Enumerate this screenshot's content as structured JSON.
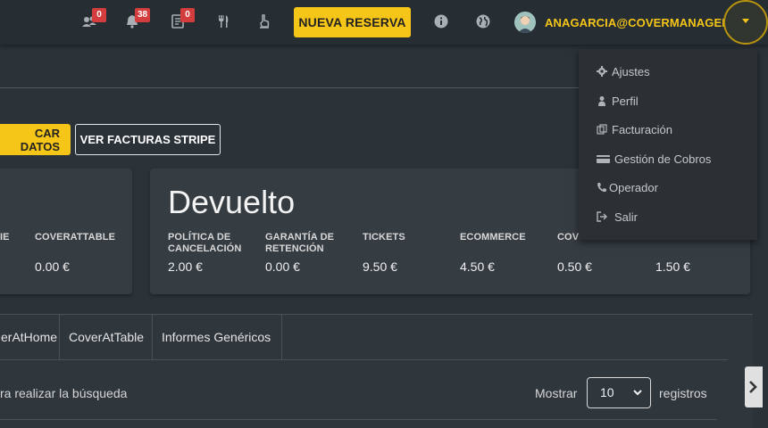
{
  "topbar": {
    "badges": {
      "groups": "0",
      "notifications": "38",
      "tasks": "0"
    },
    "reserve_label": "NUEVA RESERVA",
    "user_email": "ANAGARCIA@COVERMANAGER.COM"
  },
  "actions": {
    "buscar_label": "CAR DATOS",
    "stripe_label": "VER FACTURAS STRIPE"
  },
  "card_left": {
    "col1_label": "IE",
    "col2_label": "COVERATTABLE",
    "col2_value": "0.00 €"
  },
  "card_main": {
    "title": "Devuelto",
    "columns": [
      {
        "label": "POLÍTICA DE CANCELACIÓN",
        "value": "2.00 €"
      },
      {
        "label": "GARANTÍA DE RETENCIÓN",
        "value": "0.00 €"
      },
      {
        "label": "TICKETS",
        "value": "9.50 €"
      },
      {
        "label": "ECOMMERCE",
        "value": "4.50 €"
      },
      {
        "label": "COVE",
        "value": "0.50 €"
      },
      {
        "label": "",
        "value": "1.50 €"
      }
    ]
  },
  "tabs": [
    "erAtHome",
    "CoverAtTable",
    "Informes Genéricos"
  ],
  "table_controls": {
    "search_hint": "ra realizar la búsqueda",
    "show_label": "Mostrar",
    "page_size": "10",
    "records_label": "registros"
  },
  "menu": {
    "items": [
      "Ajustes",
      "Perfil",
      "Facturación",
      "Gestión de Cobros",
      "Operador",
      "Salir"
    ]
  }
}
